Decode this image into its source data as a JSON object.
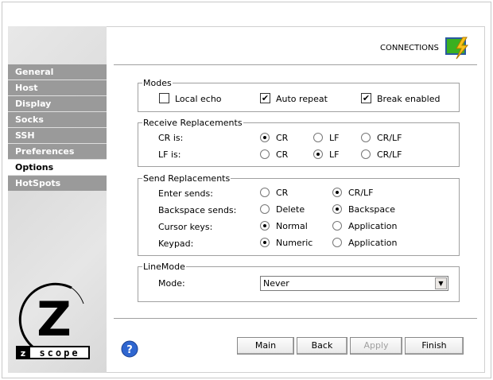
{
  "header": {
    "title": "CONNECTIONS",
    "icon": "connections-icon"
  },
  "sidebar": {
    "items": [
      {
        "label": "General"
      },
      {
        "label": "Host"
      },
      {
        "label": "Display"
      },
      {
        "label": "Socks"
      },
      {
        "label": "SSH"
      },
      {
        "label": "Preferences"
      },
      {
        "label": "Options",
        "active": true
      },
      {
        "label": "HotSpots"
      }
    ],
    "logo_text": "z/scope"
  },
  "modes": {
    "legend": "Modes",
    "local_echo": "Local echo",
    "auto_repeat": "Auto repeat",
    "break_enabled": "Break enabled",
    "local_echo_checked": false,
    "auto_repeat_checked": true,
    "break_enabled_checked": true
  },
  "receive": {
    "legend": "Receive Replacements",
    "cr_label": "CR is:",
    "lf_label": "LF is:",
    "opt_cr": "CR",
    "opt_lf": "LF",
    "opt_crlf": "CR/LF",
    "cr_value": "CR",
    "lf_value": "LF"
  },
  "send": {
    "legend": "Send Replacements",
    "enter_label": "Enter sends:",
    "enter_opts": [
      "CR",
      "CR/LF"
    ],
    "enter_value": "CR/LF",
    "backspace_label": "Backspace sends:",
    "backspace_opts": [
      "Delete",
      "Backspace"
    ],
    "backspace_value": "Backspace",
    "cursor_label": "Cursor keys:",
    "cursor_opts": [
      "Normal",
      "Application"
    ],
    "cursor_value": "Normal",
    "keypad_label": "Keypad:",
    "keypad_opts": [
      "Numeric",
      "Application"
    ],
    "keypad_value": "Numeric"
  },
  "linemode": {
    "legend": "LineMode",
    "mode_label": "Mode:",
    "mode_value": "Never"
  },
  "buttons": {
    "main": "Main",
    "back": "Back",
    "apply": "Apply",
    "finish": "Finish"
  },
  "colors": {
    "nav_bg": "#9a9a9a",
    "accent": "#3a6fd8"
  }
}
